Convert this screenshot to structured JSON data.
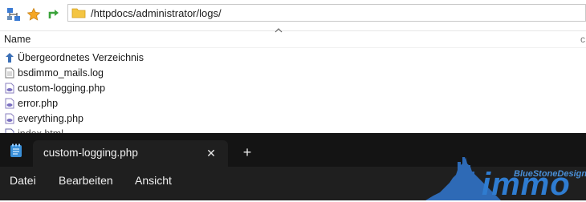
{
  "browser": {
    "toolbar_icons": [
      "network-drive-icon",
      "star-icon",
      "refresh-icon"
    ],
    "address_path": "/httpdocs/administrator/logs/",
    "column_name": "Name",
    "files": [
      {
        "label": "Übergeordnetes Verzeichnis",
        "icon": "parent-directory-icon"
      },
      {
        "label": "bsdimmo_mails.log",
        "icon": "text-file-icon"
      },
      {
        "label": "custom-logging.php",
        "icon": "php-file-icon"
      },
      {
        "label": "error.php",
        "icon": "php-file-icon"
      },
      {
        "label": "everything.php",
        "icon": "php-file-icon"
      },
      {
        "label": "index.html",
        "icon": "html-file-icon"
      }
    ]
  },
  "notepad": {
    "tab_title": "custom-logging.php",
    "menu": [
      "Datei",
      "Bearbeiten",
      "Ansicht"
    ]
  },
  "watermark": {
    "tagline": "BlueStoneDesign",
    "wordmark": "immo"
  },
  "colors": {
    "dark_bg": "#1c1c1c",
    "tabstrip_bg": "#141414",
    "accent_blue": "#2f7cd0",
    "folder_yellow": "#f4c542"
  }
}
